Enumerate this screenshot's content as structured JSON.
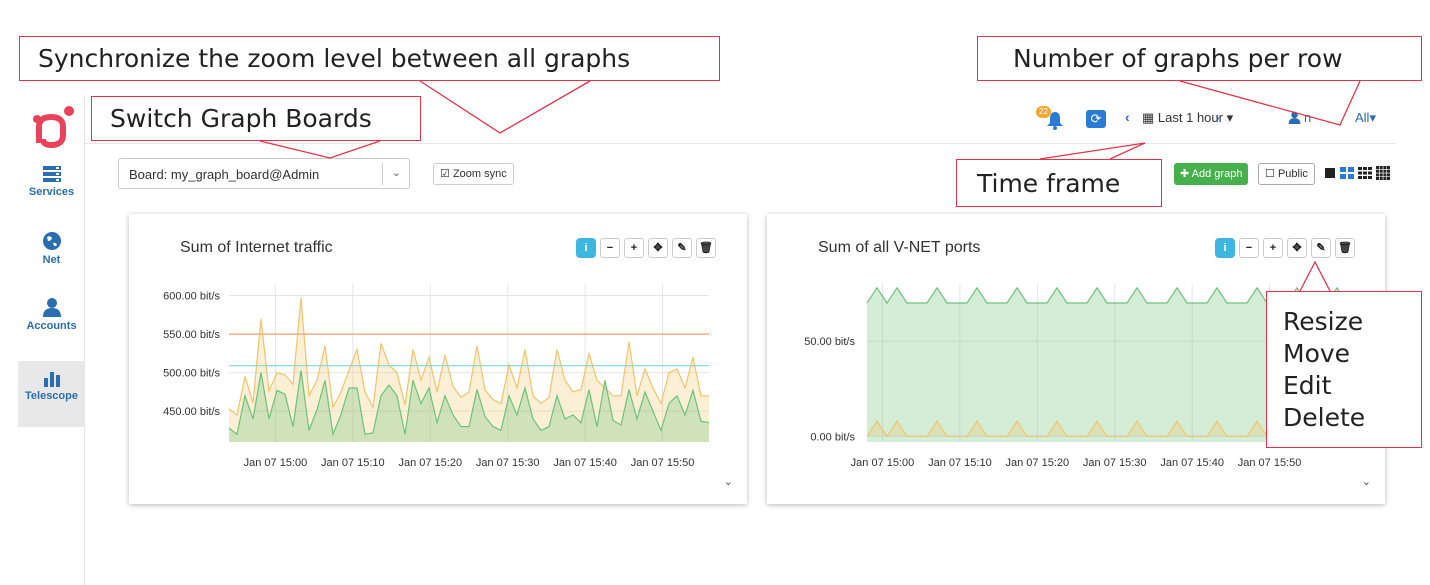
{
  "annotations": {
    "zoom_sync": "Synchronize the zoom level between all graphs",
    "per_row": "Number of graphs per row",
    "switch_boards": "Switch Graph Boards",
    "time_frame": "Time frame",
    "panel_tools": [
      "Resize",
      "Move",
      "Edit",
      "Delete"
    ]
  },
  "sidebar": {
    "items": [
      {
        "label": "Services",
        "icon": "server-icon"
      },
      {
        "label": "Net",
        "icon": "globe-icon"
      },
      {
        "label": "Accounts",
        "icon": "user-icon"
      },
      {
        "label": "Telescope",
        "icon": "bar-chart-icon",
        "active": true
      }
    ]
  },
  "header": {
    "notification_count": "22",
    "timeframe_label": "Last 1 hour ▾",
    "user_label": "n",
    "all_label": "All▾"
  },
  "board": {
    "select_value": "Board: my_graph_board@Admin",
    "zoom_sync_label": "Zoom sync",
    "add_graph_label": "Add graph",
    "public_label": "Public"
  },
  "colors": {
    "accent": "#2a7bd4",
    "add_green": "#45b04c",
    "info_blue": "#3db6e0",
    "annotation_red": "#e0344a",
    "series_green": "#6cc27a",
    "series_yellow": "#f1c46a",
    "line_orange": "#f0a070",
    "line_cyan": "#7fd6dd"
  },
  "chart_data": [
    {
      "type": "area",
      "title": "Sum of Internet traffic",
      "ylabel": "",
      "xlabel": "",
      "ylim": [
        410,
        615
      ],
      "y_ticks": [
        "600.00 bit/s",
        "550.00 bit/s",
        "500.00 bit/s",
        "450.00 bit/s"
      ],
      "y_tick_values": [
        600,
        550,
        500,
        450
      ],
      "x_ticks": [
        "Jan 07 15:00",
        "Jan 07 15:10",
        "Jan 07 15:20",
        "Jan 07 15:30",
        "Jan 07 15:40",
        "Jan 07 15:50"
      ],
      "x_range_minutes": [
        -6,
        56
      ],
      "reference_lines": [
        {
          "value": 550,
          "color": "#f0a070"
        },
        {
          "value": 509,
          "color": "#7fd6dd"
        }
      ],
      "series": [
        {
          "color": "#f1c46a",
          "values": [
            453,
            445,
            495,
            461,
            570,
            476,
            500,
            497,
            485,
            597,
            470,
            490,
            535,
            455,
            475,
            503,
            530,
            475,
            455,
            538,
            510,
            500,
            458,
            530,
            490,
            520,
            475,
            523,
            482,
            468,
            475,
            535,
            478,
            465,
            460,
            510,
            480,
            530,
            470,
            460,
            468,
            530,
            490,
            475,
            478,
            525,
            490,
            480,
            470,
            470,
            540,
            470,
            505,
            480,
            460,
            500,
            505,
            480,
            520,
            470,
            470
          ]
        },
        {
          "color": "#6cc27a",
          "values": [
            428,
            420,
            470,
            440,
            500,
            440,
            477,
            472,
            430,
            503,
            425,
            452,
            490,
            420,
            446,
            480,
            480,
            420,
            422,
            470,
            484,
            470,
            420,
            490,
            460,
            480,
            435,
            470,
            445,
            430,
            430,
            478,
            443,
            430,
            425,
            470,
            445,
            480,
            440,
            425,
            430,
            470,
            440,
            445,
            435,
            478,
            430,
            490,
            438,
            432,
            478,
            440,
            475,
            450,
            425,
            460,
            470,
            445,
            477,
            437,
            435
          ]
        }
      ]
    },
    {
      "type": "area",
      "title": "Sum of all V-NET ports",
      "ylabel": "",
      "xlabel": "",
      "ylim": [
        -3,
        80
      ],
      "y_ticks": [
        "50.00 bit/s",
        "0.00 bit/s"
      ],
      "y_tick_values": [
        50,
        0
      ],
      "x_ticks": [
        "Jan 07 15:00",
        "Jan 07 15:10",
        "Jan 07 15:20",
        "Jan 07 15:30",
        "Jan 07 15:40",
        "Jan 07 15:50"
      ],
      "x_range_minutes": [
        -2,
        60
      ],
      "series": [
        {
          "color": "#6cc27a",
          "values": [
            70,
            78,
            70,
            78,
            70,
            70,
            70,
            78,
            70,
            70,
            70,
            78,
            70,
            70,
            70,
            78,
            70,
            70,
            70,
            78,
            70,
            70,
            70,
            78,
            70,
            70,
            70,
            78,
            70,
            70,
            70,
            78,
            70,
            70,
            70,
            78,
            70,
            70,
            70,
            78,
            70,
            70,
            70,
            78,
            70,
            70,
            70,
            78,
            70
          ]
        },
        {
          "color": "#f1c46a",
          "values": [
            0,
            8,
            0,
            8,
            0,
            0,
            0,
            8,
            0,
            0,
            0,
            8,
            0,
            0,
            0,
            8,
            0,
            0,
            0,
            8,
            0,
            0,
            0,
            8,
            0,
            0,
            0,
            8,
            0,
            0,
            0,
            8,
            0,
            0,
            0,
            8,
            0,
            0,
            0,
            8,
            0,
            0,
            0,
            8,
            0,
            0,
            0,
            8,
            0
          ]
        }
      ]
    }
  ]
}
